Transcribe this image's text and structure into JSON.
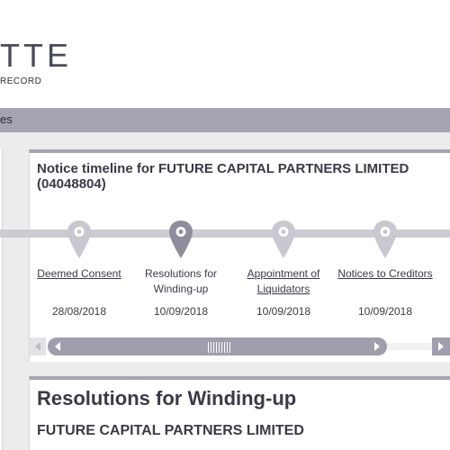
{
  "header": {
    "logo_title": "TTE",
    "logo_subtitle": "RECORD"
  },
  "nav": {
    "partial_item": "es"
  },
  "timeline": {
    "title": "Notice timeline for FUTURE CAPITAL PARTNERS LIMITED (04048804)",
    "events": [
      {
        "label": "Deemed Consent",
        "date": "28/08/2018",
        "active": false,
        "icon": "map-pin-icon"
      },
      {
        "label": "Resolutions for Winding-up",
        "date": "10/09/2018",
        "active": true,
        "icon": "map-pin-icon"
      },
      {
        "label": "Appointment of Liquidators",
        "date": "10/09/2018",
        "active": false,
        "icon": "map-pin-icon"
      },
      {
        "label": "Notices to Creditors",
        "date": "10/09/2018",
        "active": false,
        "icon": "map-pin-icon"
      }
    ],
    "colors": {
      "pin_active": "#8e8d9b",
      "pin_inactive": "#c9c8d1",
      "track": "#cbcbd3"
    }
  },
  "scrollbar": {
    "left_icon": "triangle-left-icon",
    "right_icon": "triangle-right-icon",
    "grip_icon": "grip-lines-icon"
  },
  "detail": {
    "title": "Resolutions for Winding-up",
    "company": "FUTURE CAPITAL PARTNERS LIMITED"
  },
  "theme": {
    "accent": "#a5a4b3",
    "text": "#3a3a47"
  }
}
